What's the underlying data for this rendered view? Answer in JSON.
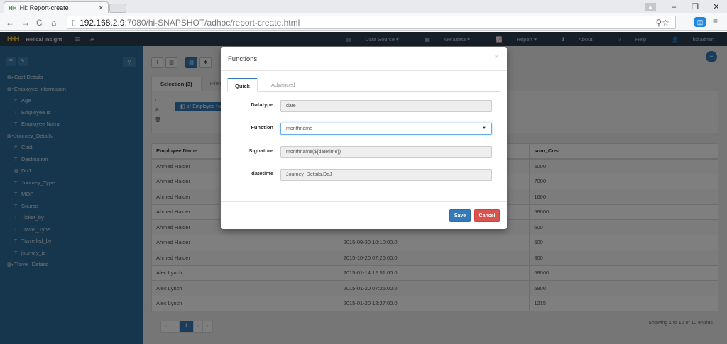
{
  "browser": {
    "tab_title": "HI: Report-create",
    "tab_favicon": "HH",
    "url_host": "192.168.2.9",
    "url_path": ":7080/hi-SNAPSHOT/adhoc/report-create.html"
  },
  "navbar": {
    "brand": "Helical Insight",
    "logo": "HHH",
    "menu": [
      {
        "icon": "▤",
        "label": "Data Source ▾"
      },
      {
        "icon": "▦",
        "label": "Metadata ▾"
      },
      {
        "icon": "📈",
        "label": "Report ▾"
      },
      {
        "icon": "ℹ",
        "label": "About"
      },
      {
        "icon": "?",
        "label": "Help"
      },
      {
        "icon": "👤",
        "label": "hdiadmin"
      }
    ]
  },
  "sidebar": {
    "items": [
      {
        "label": "Cost Details",
        "level": 1,
        "icon": "▦▸"
      },
      {
        "label": "Employee Information",
        "level": 1,
        "icon": "▦▾"
      },
      {
        "label": "Age",
        "level": 2,
        "icon": "#"
      },
      {
        "label": "Employee Id",
        "level": 2,
        "icon": "T"
      },
      {
        "label": "Employee Name",
        "level": 2,
        "icon": "T"
      },
      {
        "label": "Journey_Details",
        "level": 1,
        "icon": "▦▾"
      },
      {
        "label": "Cost",
        "level": 2,
        "icon": "#"
      },
      {
        "label": "Destination",
        "level": 2,
        "icon": "T"
      },
      {
        "label": "DoJ",
        "level": 2,
        "icon": "▦"
      },
      {
        "label": "Journey_Type",
        "level": 2,
        "icon": "T"
      },
      {
        "label": "MOP",
        "level": 2,
        "icon": "T"
      },
      {
        "label": "Source",
        "level": 2,
        "icon": "T"
      },
      {
        "label": "Ticket_by",
        "level": 2,
        "icon": "T"
      },
      {
        "label": "Travel_Type",
        "level": 2,
        "icon": "T"
      },
      {
        "label": "Travelled_by",
        "level": 2,
        "icon": "T"
      },
      {
        "label": "journey_id",
        "level": 2,
        "icon": "T"
      },
      {
        "label": "Travel_Details",
        "level": 1,
        "icon": "▦▸"
      }
    ]
  },
  "main": {
    "tabs": [
      {
        "label": "Selection (3)"
      },
      {
        "label": "Filters"
      }
    ],
    "chip": "◧ a° Employee Na",
    "table": {
      "columns": [
        "Employee Name",
        "",
        "sum_Cost"
      ],
      "rows": [
        [
          "Ahmed Haider",
          "",
          "5000"
        ],
        [
          "Ahmed Haider",
          "",
          "7000"
        ],
        [
          "Ahmed Haider",
          "",
          "1600"
        ],
        [
          "Ahmed Haider",
          "",
          "68000"
        ],
        [
          "Ahmed Haider",
          "",
          "600"
        ],
        [
          "Ahmed Haider",
          "2015-09-30 10:10:00.0",
          "500"
        ],
        [
          "Ahmed Haider",
          "2015-10-20 07:26:00.0",
          "800"
        ],
        [
          "Alec Lynch",
          "2015-01-14 12:51:00.0",
          "58000"
        ],
        [
          "Alec Lynch",
          "2015-01-20 07:26:00.0",
          "6800"
        ],
        [
          "Alec Lynch",
          "2015-01-20 12:27:00.0",
          "1215"
        ]
      ]
    },
    "pager": {
      "first": "«",
      "prev": "‹",
      "page": "1",
      "next": "›",
      "last": "»"
    },
    "showing": "Showing 1 to 10 of 10 entries"
  },
  "modal": {
    "title": "Functions",
    "close": "×",
    "tabs": {
      "quick": "Quick",
      "advanced": "Advanced"
    },
    "fields": {
      "datatype_label": "Datatype",
      "datatype_value": "date",
      "function_label": "Function",
      "function_value": "monthname",
      "signature_label": "Signature",
      "signature_value": "monthname(${datetime})",
      "datetime_label": "datetime",
      "datetime_value": "Journey_Details.DoJ"
    },
    "save": "Save",
    "cancel": "Cancel"
  },
  "colors": {
    "navbar": "#2c3e50",
    "sidebar": "#2a6c9b",
    "primary": "#337ab7",
    "danger": "#d9534f"
  }
}
